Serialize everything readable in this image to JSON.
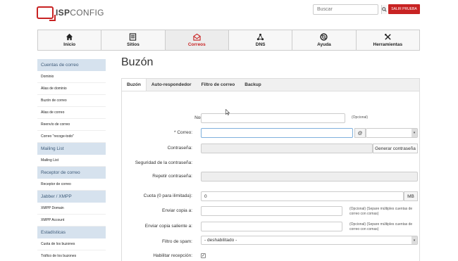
{
  "brand": {
    "part1": "ISP",
    "part2": "CONFIG"
  },
  "header": {
    "search_placeholder": "Buscar",
    "logout_label": "SALIR PRUEBA"
  },
  "nav": [
    {
      "label": "Inicio",
      "icon": "home-icon"
    },
    {
      "label": "Sitios",
      "icon": "sites-icon"
    },
    {
      "label": "Correos",
      "icon": "mail-icon",
      "active": true
    },
    {
      "label": "DNS",
      "icon": "dns-icon"
    },
    {
      "label": "Ayuda",
      "icon": "help-icon"
    },
    {
      "label": "Herramientas",
      "icon": "tools-icon"
    }
  ],
  "sidebar": {
    "sections": [
      {
        "title": "Cuentas de correo",
        "items": [
          "Dominio",
          "Alias de dominio",
          "Buzón de correo",
          "Alias de correo",
          "Reenvío de correo",
          "Correo \"recoge-todo\""
        ]
      },
      {
        "title": "Mailing List",
        "items": [
          "Mailing List"
        ]
      },
      {
        "title": "Receptor de correo",
        "items": [
          "Receptor de correo"
        ]
      },
      {
        "title": "Jabber / XMPP",
        "items": [
          "XMPP Domain",
          "XMPP Account"
        ]
      },
      {
        "title": "Estadísticas",
        "items": [
          "Cuota de los buzones",
          "Tráfico de los buzones"
        ]
      }
    ]
  },
  "page": {
    "title": "Buzón"
  },
  "tabs": [
    "Buzón",
    "Auto-respondedor",
    "Filtro de correo",
    "Backup"
  ],
  "form": {
    "name_label": "Nombre:",
    "name_hint": "(Opcional)",
    "email_label": "* Correo:",
    "at_sign": "@",
    "password_label": "Contraseña:",
    "generate_label": "Generar contraseña",
    "strength_label": "Seguridad de la contraseña:",
    "repeat_label": "Repetir contraseña:",
    "quota_label": "Cuota (0 para ilimitada):",
    "quota_value": "0",
    "quota_unit": "MB",
    "cc_label": "Enviar copia a:",
    "cc_hint": "(Opcional) (Separe múltiples cuentas de correo con comas)",
    "bcc_label": "Enviar copia saliente a:",
    "bcc_hint": "(Opcional) (Separe múltiples cuentas de correo con comas)",
    "spam_label": "Filtro de spam:",
    "spam_value": "- deshabilitado -",
    "receive_label": "Habilitar recepción:",
    "receive_checked": "✓"
  },
  "colors": {
    "brand_red": "#c82323",
    "sidebar_head": "#d6e2ee"
  }
}
